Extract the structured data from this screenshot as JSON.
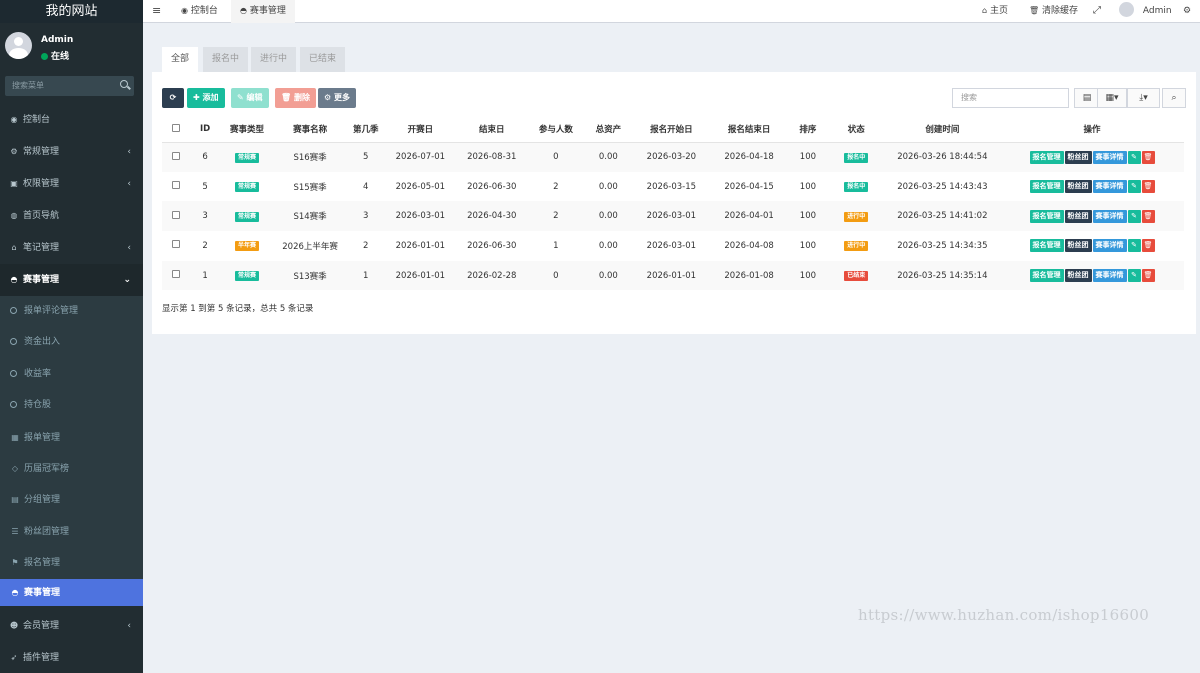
{
  "sidebar": {
    "logo": "我的网站",
    "user": {
      "name": "Admin",
      "status": "在线"
    },
    "search_placeholder": "搜索菜单",
    "menu": [
      {
        "label": "控制台",
        "icon": "dashboard-icon",
        "glyph": "◉",
        "chevron": ""
      },
      {
        "label": "常规管理",
        "icon": "cogs-icon",
        "glyph": "⚙",
        "chevron": "‹"
      },
      {
        "label": "权限管理",
        "icon": "group-icon",
        "glyph": "▣",
        "chevron": "‹"
      },
      {
        "label": "首页导航",
        "icon": "circle-icon",
        "glyph": "◍",
        "chevron": ""
      },
      {
        "label": "笔记管理",
        "icon": "home-icon",
        "glyph": "⌂",
        "chevron": "‹"
      },
      {
        "label": "赛事管理",
        "icon": "gamepad-icon",
        "glyph": "◓",
        "chevron": "⌄"
      }
    ],
    "submenu": [
      {
        "label": "报单评论管理",
        "kind": "circle"
      },
      {
        "label": "资金出入",
        "kind": "circle"
      },
      {
        "label": "收益率",
        "kind": "circle"
      },
      {
        "label": "持仓股",
        "kind": "circle"
      },
      {
        "label": "报单管理",
        "kind": "icon",
        "icon": "calendar-icon",
        "glyph": "▦"
      },
      {
        "label": "历届冠军榜",
        "kind": "icon",
        "icon": "diamond-icon",
        "glyph": "◇"
      },
      {
        "label": "分组管理",
        "kind": "icon",
        "icon": "window-icon",
        "glyph": "▤"
      },
      {
        "label": "粉丝团管理",
        "kind": "icon",
        "icon": "list-icon",
        "glyph": "☰"
      },
      {
        "label": "报名管理",
        "kind": "icon",
        "icon": "flag-icon",
        "glyph": "⚑"
      },
      {
        "label": "赛事管理",
        "kind": "icon",
        "icon": "gamepad-icon",
        "glyph": "◓",
        "active": true
      }
    ],
    "bottom_menu": [
      {
        "label": "会员管理",
        "icon": "user-circle-icon",
        "glyph": "☻",
        "chevron": "‹"
      },
      {
        "label": "插件管理",
        "icon": "rocket-icon",
        "glyph": "➶",
        "chevron": ""
      }
    ]
  },
  "topbar": {
    "menu_toggle": "≡",
    "tabs": [
      {
        "label": "控制台",
        "icon": "dashboard-icon",
        "glyph": "◉"
      },
      {
        "label": "赛事管理",
        "icon": "gamepad-icon",
        "glyph": "◓",
        "active": true
      }
    ],
    "home": "主页",
    "clear_cache": "清除缓存",
    "user": "Admin"
  },
  "content": {
    "tabs": [
      "全部",
      "报名中",
      "进行中",
      "已结束"
    ],
    "toolbar": {
      "add": "添加",
      "edit": "编辑",
      "delete": "删除",
      "more": "更多"
    },
    "search_placeholder": "搜索",
    "table": {
      "headers": [
        "ID",
        "赛事类型",
        "赛事名称",
        "第几季",
        "开赛日",
        "结束日",
        "参与人数",
        "总资产",
        "报名开始日",
        "报名结束日",
        "排序",
        "状态",
        "创建时间",
        "操作"
      ],
      "rows": [
        {
          "id": "6",
          "type": "常规赛",
          "type_color": "#18bc9c",
          "name": "S16赛季",
          "season": "5",
          "start": "2026-07-01",
          "end": "2026-08-31",
          "people": "0",
          "assets": "0.00",
          "reg_start": "2026-03-20",
          "reg_end": "2026-04-18",
          "sort": "100",
          "status": "报名中",
          "status_color": "#18bc9c",
          "created": "2026-03-26 18:44:54"
        },
        {
          "id": "5",
          "type": "常规赛",
          "type_color": "#18bc9c",
          "name": "S15赛季",
          "season": "4",
          "start": "2026-05-01",
          "end": "2026-06-30",
          "people": "2",
          "assets": "0.00",
          "reg_start": "2026-03-15",
          "reg_end": "2026-04-15",
          "sort": "100",
          "status": "报名中",
          "status_color": "#18bc9c",
          "created": "2026-03-25 14:43:43"
        },
        {
          "id": "3",
          "type": "常规赛",
          "type_color": "#18bc9c",
          "name": "S14赛季",
          "season": "3",
          "start": "2026-03-01",
          "end": "2026-04-30",
          "people": "2",
          "assets": "0.00",
          "reg_start": "2026-03-01",
          "reg_end": "2026-04-01",
          "sort": "100",
          "status": "进行中",
          "status_color": "#f39c12",
          "created": "2026-03-25 14:41:02"
        },
        {
          "id": "2",
          "type": "半年赛",
          "type_color": "#f39c12",
          "name": "2026上半年赛",
          "season": "2",
          "start": "2026-01-01",
          "end": "2026-06-30",
          "people": "1",
          "assets": "0.00",
          "reg_start": "2026-03-01",
          "reg_end": "2026-04-08",
          "sort": "100",
          "status": "进行中",
          "status_color": "#f39c12",
          "created": "2026-03-25 14:34:35"
        },
        {
          "id": "1",
          "type": "常规赛",
          "type_color": "#18bc9c",
          "name": "S13赛季",
          "season": "1",
          "start": "2026-01-01",
          "end": "2026-02-28",
          "people": "0",
          "assets": "0.00",
          "reg_start": "2026-01-01",
          "reg_end": "2026-01-08",
          "sort": "100",
          "status": "已结束",
          "status_color": "#e74c3c",
          "created": "2026-03-25 14:35:14"
        }
      ],
      "row_actions": [
        {
          "label": "报名管理",
          "color": "#18bc9c"
        },
        {
          "label": "粉丝团",
          "color": "#2c3e50"
        },
        {
          "label": "赛事详情",
          "color": "#3498db"
        }
      ]
    },
    "summary": "显示第 1 到第 5 条记录，总共 5 条记录"
  },
  "watermark": "https://www.huzhan.com/ishop16600"
}
